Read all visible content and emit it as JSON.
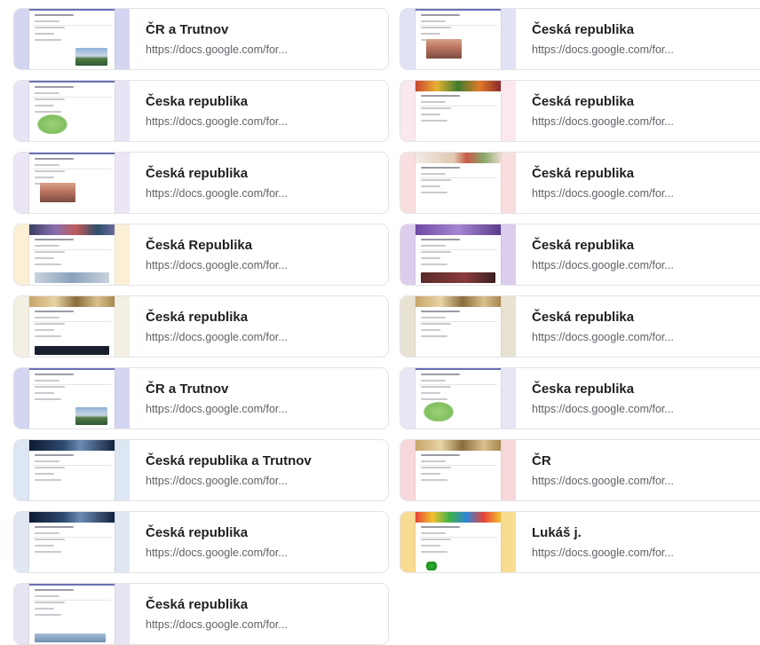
{
  "cards": [
    {
      "title": "ČR a Trutnov",
      "url": "https://docs.google.com/for...",
      "theme_color": "#d4d6f1",
      "header_image": false,
      "preview_image": "mountain-landscape"
    },
    {
      "title": "Česká republika",
      "url": "https://docs.google.com/for...",
      "theme_color": "#e1e2f4",
      "header_image": false,
      "preview_image": "sunset-landscape"
    },
    {
      "title": "Česka republika",
      "url": "https://docs.google.com/for...",
      "theme_color": "#e8e3f5",
      "header_image": false,
      "preview_image": "map-of-czechia"
    },
    {
      "title": "Česká republika",
      "url": "https://docs.google.com/for...",
      "theme_color": "#fbe8ef",
      "header_image": true,
      "preview_image": "fruit-header"
    },
    {
      "title": "Česká republika",
      "url": "https://docs.google.com/for...",
      "theme_color": "#ebe5f6",
      "header_image": false,
      "preview_image": "sunset-landscape"
    },
    {
      "title": "Česká republika",
      "url": "https://docs.google.com/for...",
      "theme_color": "#f8dede",
      "header_image": true,
      "preview_image": "food-header"
    },
    {
      "title": "Česká Republika",
      "url": "https://docs.google.com/for...",
      "theme_color": "#fbefd6",
      "header_image": true,
      "preview_image": "abstract-header"
    },
    {
      "title": "Česká republika",
      "url": "https://docs.google.com/for...",
      "theme_color": "#dccdec",
      "header_image": true,
      "preview_image": "purple-header"
    },
    {
      "title": "Česká republika",
      "url": "https://docs.google.com/for...",
      "theme_color": "#f3efe2",
      "header_image": true,
      "preview_image": "book-header"
    },
    {
      "title": "Česká republika",
      "url": "https://docs.google.com/for...",
      "theme_color": "#e7e2d2",
      "header_image": true,
      "preview_image": "book-header"
    },
    {
      "title": "ČR a Trutnov",
      "url": "https://docs.google.com/for...",
      "theme_color": "#d4d6f1",
      "header_image": false,
      "preview_image": "mountain-landscape"
    },
    {
      "title": "Česka republika",
      "url": "https://docs.google.com/for...",
      "theme_color": "#e8e5f4",
      "header_image": false,
      "preview_image": "map-of-czechia"
    },
    {
      "title": "Česká republika a Trutnov",
      "url": "https://docs.google.com/for...",
      "theme_color": "#dde6f3",
      "header_image": true,
      "preview_image": "night-header"
    },
    {
      "title": "ČR",
      "url": "https://docs.google.com/for...",
      "theme_color": "#f6d8da",
      "header_image": true,
      "preview_image": "book-header"
    },
    {
      "title": "Česká republika",
      "url": "https://docs.google.com/for...",
      "theme_color": "#e0e6f2",
      "header_image": true,
      "preview_image": "night-header"
    },
    {
      "title": "Lukáš j.",
      "url": "https://docs.google.com/for...",
      "theme_color": "#f8dc92",
      "header_image": true,
      "preview_image": "candy-header"
    },
    {
      "title": "Česká republika",
      "url": "https://docs.google.com/for...",
      "theme_color": "#e6e4f2",
      "header_image": false,
      "preview_image": "landscape-footer"
    }
  ]
}
